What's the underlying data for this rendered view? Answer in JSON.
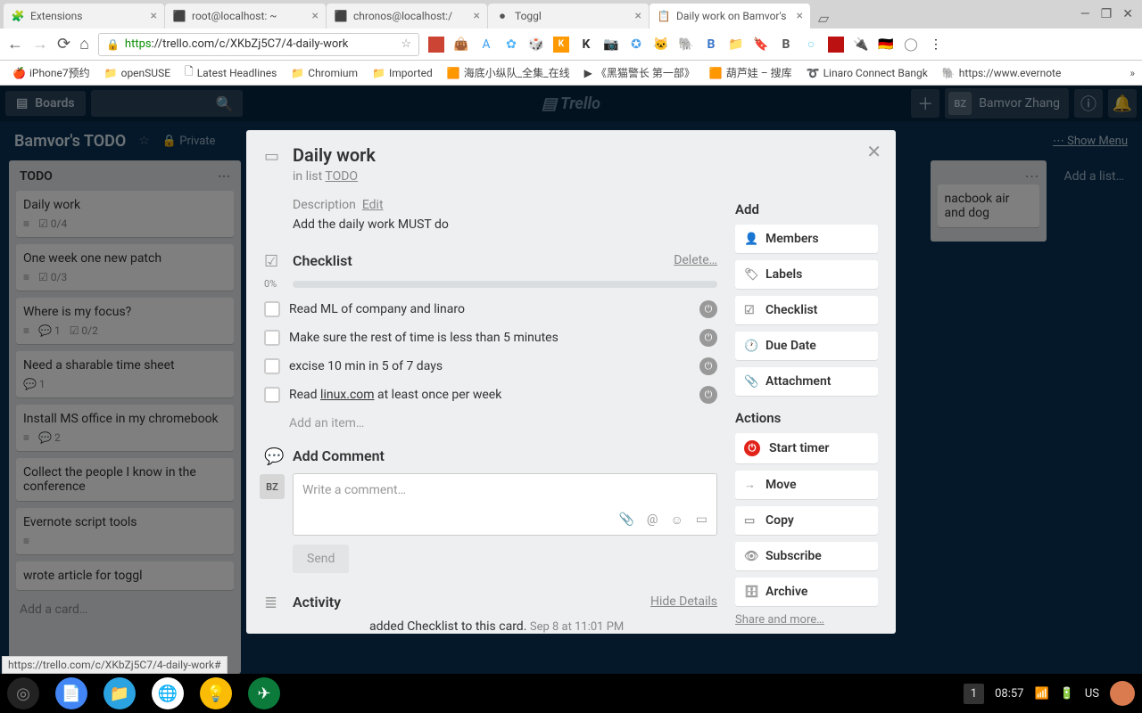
{
  "browser": {
    "tabs": [
      {
        "title": "Extensions",
        "favicon": "🧩"
      },
      {
        "title": "root@localhost: ~",
        "favicon": "⬛"
      },
      {
        "title": "chronos@localhost:/",
        "favicon": "⬛"
      },
      {
        "title": "Toggl",
        "favicon": "⏺"
      },
      {
        "title": "Daily work on Bamvor's",
        "favicon": "📋"
      }
    ],
    "url_prefix": "https",
    "url_host": "://trello.com",
    "url_path": "/c/XKbZj5C7/4-daily-work",
    "bookmarks": [
      "iPhone7预约",
      "openSUSE",
      "Latest Headlines",
      "Chromium",
      "Imported",
      "海底小纵队_全集_在线",
      "《黑猫警长 第一部》",
      "葫芦娃 – 搜库",
      "Linaro Connect Bangk",
      "https://www.evernote"
    ]
  },
  "trello": {
    "boards_label": "Boards",
    "user_initials": "BZ",
    "user_name": "Bamvor Zhang",
    "board_name": "Bamvor's TODO",
    "private": "Private",
    "show_menu": "Show Menu",
    "list_name": "TODO",
    "add_list": "Add a list…",
    "add_card": "Add a card…",
    "cards": [
      {
        "title": "Daily work",
        "checklist": "0/4"
      },
      {
        "title": "One week one new patch",
        "checklist": "0/3"
      },
      {
        "title": "Where is my focus?",
        "comments": "1",
        "checklist": "0/2"
      },
      {
        "title": "Need a sharable time sheet",
        "comments": "1"
      },
      {
        "title": "Install MS office in my chromebook",
        "comments": "2"
      },
      {
        "title": "Collect the people I know in the conference"
      },
      {
        "title": "Evernote script tools"
      },
      {
        "title": "wrote article for toggl"
      }
    ],
    "peek_card": "nacbook air and dog"
  },
  "modal": {
    "title": "Daily work",
    "in_list_prefix": "in list ",
    "in_list_name": "TODO",
    "description_label": "Description",
    "edit_label": "Edit",
    "description_text": "Add the daily work MUST do",
    "checklist_title": "Checklist",
    "delete_label": "Delete…",
    "progress": "0%",
    "checklist_items": [
      {
        "text": "Read ML of company and linaro"
      },
      {
        "text": "Make sure the rest of time is less than 5 minutes"
      },
      {
        "text": "excise 10 min in 5 of 7 days"
      },
      {
        "text_pre": "Read ",
        "link": "linux.com",
        "text_post": " at least once per week"
      }
    ],
    "add_item": "Add an item…",
    "add_comment_title": "Add Comment",
    "comment_placeholder": "Write a comment…",
    "send": "Send",
    "activity_title": "Activity",
    "hide_details": "Hide Details",
    "activity_entry": "added Checklist to this card.",
    "activity_time": "Sep 8 at 11:01 PM",
    "add": "Add",
    "actions": "Actions",
    "side_add": [
      "Members",
      "Labels",
      "Checklist",
      "Due Date",
      "Attachment"
    ],
    "side_actions": [
      "Start timer",
      "Move",
      "Copy",
      "Subscribe",
      "Archive"
    ],
    "share": "Share and more…"
  },
  "status_link": "https://trello.com/c/XKbZj5C7/4-daily-work#",
  "taskbar": {
    "count": "1",
    "time": "08:57",
    "lang": "US"
  }
}
